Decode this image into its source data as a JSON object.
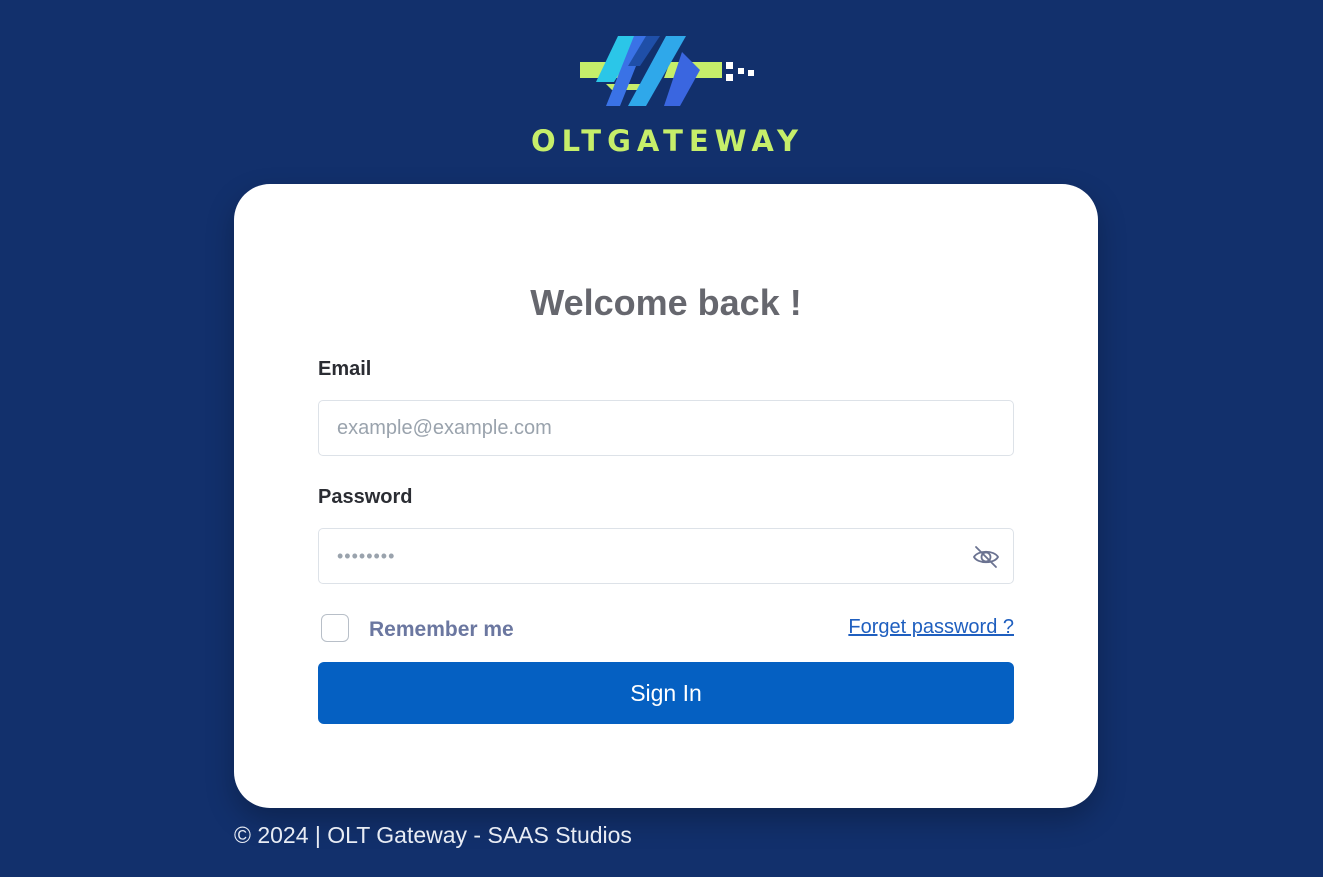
{
  "brand": {
    "name": "OLTGATEWAY",
    "accent_green": "#c6ee6a",
    "accent_blue": "#2f7fe8",
    "accent_cyan": "#2bc6e8"
  },
  "login": {
    "title": "Welcome back !",
    "email_label": "Email",
    "email_placeholder": "example@example.com",
    "email_value": "",
    "password_label": "Password",
    "password_placeholder": "••••••••",
    "password_value": "",
    "password_toggle_icon": "eye-slash-icon",
    "remember_label": "Remember me",
    "remember_checked": false,
    "forgot_label": "Forget password ?",
    "submit_label": "Sign In"
  },
  "footer": {
    "text": "© 2024 | OLT Gateway - SAAS Studios"
  },
  "colors": {
    "background": "#12306c",
    "card": "#ffffff",
    "primary_button": "#0560c2",
    "link": "#1f5fbf"
  }
}
